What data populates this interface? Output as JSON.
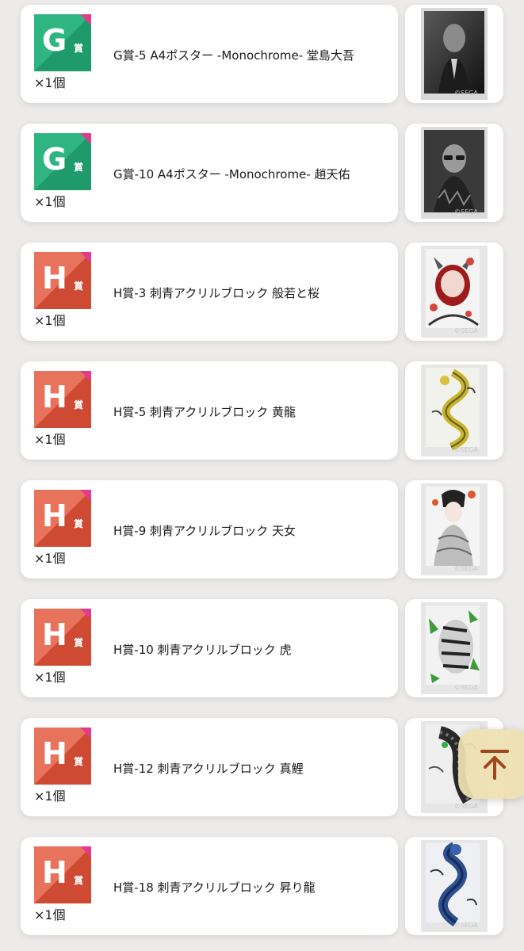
{
  "prizes": [
    {
      "badge_letter": "G",
      "badge_suffix": "賞",
      "qty": "×1個",
      "title": "G賞-5 A4ポスター -Monochrome- 堂島大吾",
      "image": "portrait-photo-suit"
    },
    {
      "badge_letter": "G",
      "badge_suffix": "賞",
      "qty": "×1個",
      "title": "G賞-10 A4ポスター -Monochrome- 趙天佑",
      "image": "portrait-photo-sunglasses"
    },
    {
      "badge_letter": "H",
      "badge_suffix": "賞",
      "qty": "×1個",
      "title": "H賞-3 刺青アクリルブロック 般若と桜",
      "image": "tattoo-hannya-sakura"
    },
    {
      "badge_letter": "H",
      "badge_suffix": "賞",
      "qty": "×1個",
      "title": "H賞-5 刺青アクリルブロック 黄龍",
      "image": "tattoo-yellow-dragon"
    },
    {
      "badge_letter": "H",
      "badge_suffix": "賞",
      "qty": "×1個",
      "title": "H賞-9 刺青アクリルブロック 天女",
      "image": "tattoo-tennyo"
    },
    {
      "badge_letter": "H",
      "badge_suffix": "賞",
      "qty": "×1個",
      "title": "H賞-10 刺青アクリルブロック 虎",
      "image": "tattoo-tiger"
    },
    {
      "badge_letter": "H",
      "badge_suffix": "賞",
      "qty": "×1個",
      "title": "H賞-12 刺青アクリルブロック 真鯉",
      "image": "tattoo-koi"
    },
    {
      "badge_letter": "H",
      "badge_suffix": "賞",
      "qty": "×1個",
      "title": "H賞-18 刺青アクリルブロック 昇り龍",
      "image": "tattoo-rising-dragon"
    }
  ],
  "thumb_watermark": "©SEGA",
  "scroll_top_icon": "arrow-up-to-top-icon",
  "colors": {
    "g_badge_light": "#2fb582",
    "g_badge_dark": "#1f9a6a",
    "h_badge_light": "#e8735c",
    "h_badge_dark": "#cf4a32",
    "badge_corner": "#e5398d",
    "card_bg": "#ffffff",
    "page_bg": "#ecebea",
    "scroll_top_bg": "#eee0b0",
    "scroll_top_arrow": "#a0461d"
  }
}
